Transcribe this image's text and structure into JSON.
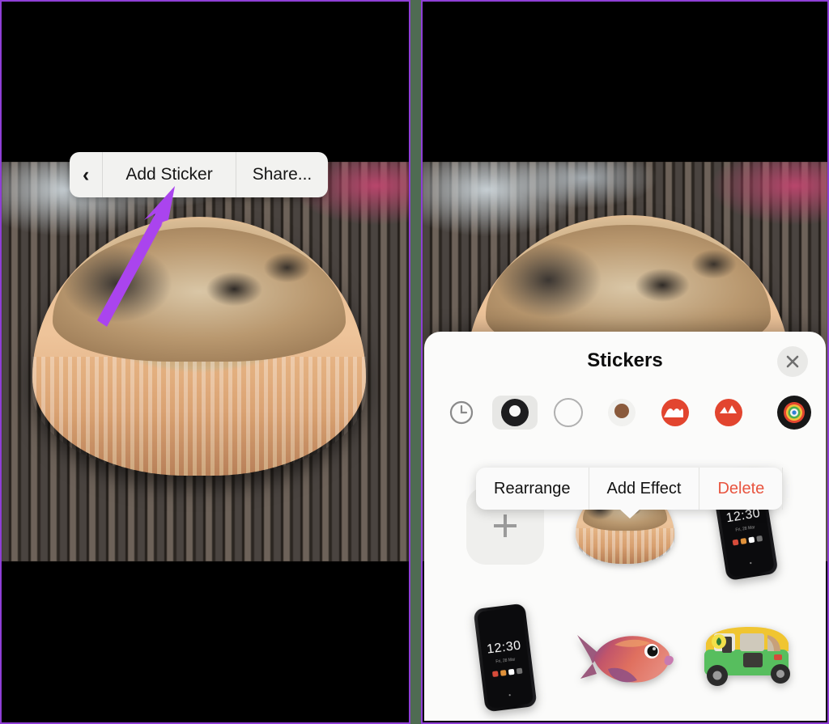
{
  "annotation": {
    "arrow_color": "#aa44ee",
    "points_to": "Add Sticker"
  },
  "panel_divider": {
    "gap_color": "#4f6b52",
    "border_color": "#8f3fd6"
  },
  "left_panel": {
    "toolbar": {
      "back_icon": "chevron-left-icon",
      "back_label": "‹",
      "add_sticker_label": "Add Sticker",
      "share_label": "Share..."
    }
  },
  "right_panel": {
    "sheet": {
      "title": "Stickers",
      "close_icon": "close-icon",
      "close_label": "×"
    },
    "tabs": [
      {
        "id": "recents",
        "icon": "clock-icon",
        "selected": false
      },
      {
        "id": "smileys",
        "icon": "emoji-smiley-icon",
        "selected": true
      },
      {
        "id": "people",
        "icon": "emoji-people-icon",
        "selected": false
      },
      {
        "id": "animals",
        "icon": "emoji-animals-icon",
        "selected": false
      },
      {
        "id": "food",
        "icon": "emoji-food-icon",
        "selected": false
      },
      {
        "id": "objects",
        "icon": "emoji-objects-icon",
        "selected": false
      }
    ],
    "tab_trailing": {
      "id": "more",
      "icon": "emoji-target-icon"
    },
    "context_menu": {
      "items": [
        {
          "label": "Rearrange",
          "style": "default"
        },
        {
          "label": "Add Effect",
          "style": "default"
        },
        {
          "label": "Delete",
          "style": "destructive",
          "color": "#e8543f"
        }
      ]
    },
    "stickers": [
      {
        "type": "add",
        "name": "add-sticker-tile",
        "label": "+"
      },
      {
        "type": "tart",
        "name": "sticker-tart",
        "label": ""
      },
      {
        "type": "phone",
        "name": "sticker-phone-1",
        "label": "12:30",
        "sublabel": "Fri, 28 Mar"
      },
      {
        "type": "phone",
        "name": "sticker-phone-2",
        "label": "12:30",
        "sublabel": "Fri, 28 Mar"
      },
      {
        "type": "fish",
        "name": "sticker-fish",
        "label": ""
      },
      {
        "type": "auto",
        "name": "sticker-auto-rickshaw",
        "label": ""
      }
    ]
  }
}
